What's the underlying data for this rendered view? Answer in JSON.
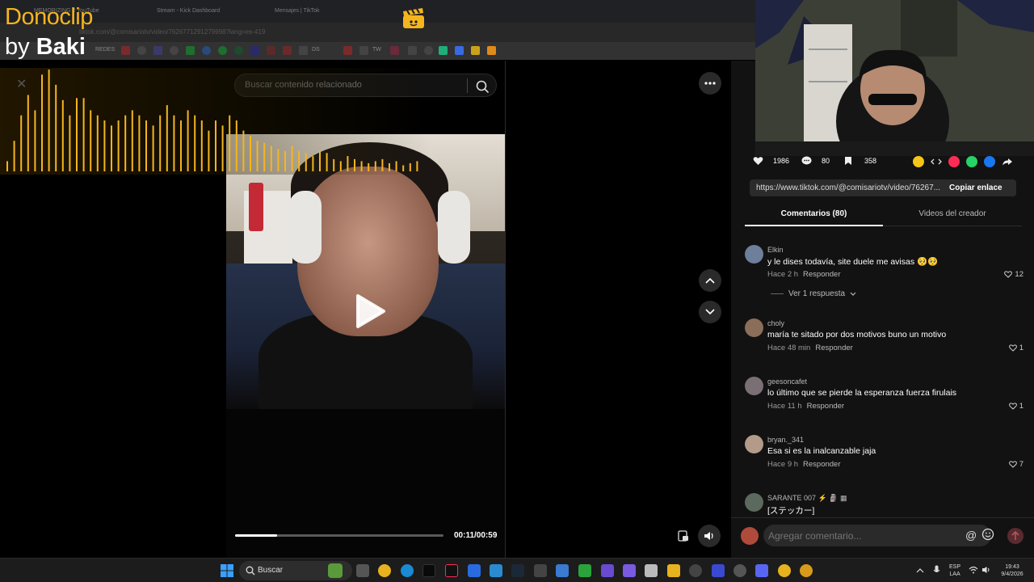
{
  "browser": {
    "tabs": [
      {
        "label": "MEMORIZING 2 YouTube"
      },
      {
        "label": "Stream - Kick Dashboard"
      },
      {
        "label": "Mensajes | TikTok"
      }
    ],
    "url": "tiktok.com/@comisariotv/video/7626771291279998?lang=es-419",
    "bookmark_labels": [
      "REDES",
      "DS",
      "TW"
    ]
  },
  "overlay": {
    "title": "Donoclip",
    "by_prefix": "by",
    "by_name": "Baki",
    "close_glyph": "✕",
    "visualizer_levels": [
      0.1,
      0.3,
      0.55,
      0.75,
      0.6,
      0.95,
      1.0,
      0.85,
      0.7,
      0.55,
      0.72,
      0.72,
      0.6,
      0.55,
      0.5,
      0.45,
      0.5,
      0.55,
      0.6,
      0.55,
      0.5,
      0.45,
      0.55,
      0.65,
      0.55,
      0.5,
      0.6,
      0.55,
      0.5,
      0.4,
      0.5,
      0.45,
      0.55,
      0.5,
      0.4,
      0.35,
      0.3,
      0.28,
      0.25,
      0.22,
      0.2,
      0.25,
      0.2,
      0.18,
      0.15,
      0.2,
      0.18,
      0.12,
      0.1,
      0.15,
      0.12,
      0.1,
      0.08,
      0.1,
      0.12,
      0.08,
      0.1,
      0.06,
      0.08,
      0.1
    ]
  },
  "search": {
    "placeholder": "Buscar contenido relacionado"
  },
  "video": {
    "time": "00:11/00:59",
    "progress": 0.2
  },
  "stats": {
    "likes": "1986",
    "comments": "80",
    "saves": "358"
  },
  "share": {
    "link": "https://www.tiktok.com/@comisariotv/video/76267...",
    "copy_label": "Copiar enlace"
  },
  "tabs": {
    "comments": "Comentarios (80)",
    "videos": "Videos del creador"
  },
  "comments": [
    {
      "user": "Elkin",
      "text": "y le dises todavía, site duele me avisas 🥺🥺",
      "time": "Hace 2 h",
      "reply": "Responder",
      "likes": "12",
      "avatar_color": "#6d7f9a"
    },
    {
      "user": "choly",
      "text": "maría te sitado por dos motivos buno un motivo",
      "time": "Hace 48 min",
      "reply": "Responder",
      "likes": "1",
      "avatar_color": "#8a6e5a"
    },
    {
      "user": "geesoncafet",
      "text": "lo último que se pierde la esperanza fuerza firulais",
      "time": "Hace 11 h",
      "reply": "Responder",
      "likes": "1",
      "avatar_color": "#7a6f74"
    },
    {
      "user": "bryan._341",
      "text": "Esa si es la inalcanzable jaja",
      "time": "Hace 9 h",
      "reply": "Responder",
      "likes": "7",
      "avatar_color": "#b49a88"
    },
    {
      "user": "SARANTE 007 ⚡ 🗿 ▦",
      "text": "[ステッカー]",
      "time": "",
      "reply": "",
      "likes": "",
      "avatar_color": "#5b6a5c"
    }
  ],
  "view_replies": "Ver 1 respuesta",
  "comment_input": {
    "placeholder": "Agregar comentario...",
    "at": "@"
  },
  "taskbar": {
    "search_label": "Buscar",
    "lang_top": "ESP",
    "lang_bottom": "LAA",
    "clock_time": "19:43",
    "clock_date": "9/4/2026"
  },
  "colors": {
    "accent": "#f5b51f",
    "tiktok_red": "#fe2c55",
    "panel_bg": "#121212"
  }
}
